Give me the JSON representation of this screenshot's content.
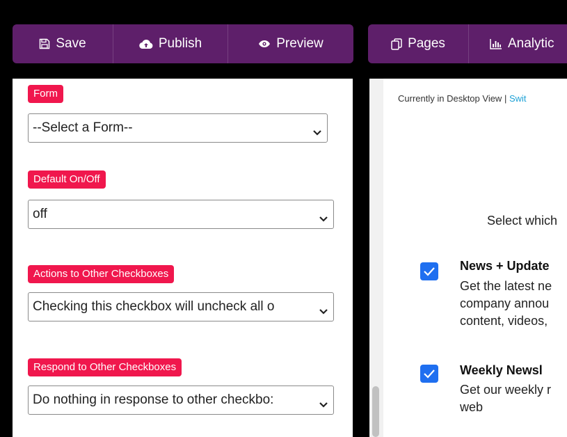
{
  "toolbar_left": [
    {
      "label": "Save",
      "icon": "floppy-disk-icon"
    },
    {
      "label": "Publish",
      "icon": "cloud-upload-icon"
    },
    {
      "label": "Preview",
      "icon": "eye-icon"
    }
  ],
  "toolbar_right": [
    {
      "label": "Pages",
      "icon": "pages-icon"
    },
    {
      "label": "Analytic",
      "icon": "bar-chart-icon"
    }
  ],
  "fields": {
    "form": {
      "label": "Form",
      "value": "--Select a Form--"
    },
    "default": {
      "label": "Default On/Off",
      "value": "off"
    },
    "actions": {
      "label": "Actions to Other Checkboxes",
      "value": "Checking this checkbox will uncheck all o"
    },
    "respond": {
      "label": "Respond to Other Checkboxes",
      "value": "Do nothing in response to other checkbo:"
    }
  },
  "preview": {
    "status_text": "Currently in Desktop View",
    "separator": "|",
    "switch_link": "Swit",
    "intro": "Select which",
    "options": [
      {
        "title": "News + Update",
        "desc": [
          "Get the latest ne",
          "company annou",
          "content, videos,"
        ],
        "checked": true
      },
      {
        "title": "Weekly Newsl",
        "desc": [
          "Get our weekly r",
          "web"
        ],
        "checked": true
      }
    ]
  },
  "colors": {
    "toolbar_bg": "#5e1f6a",
    "label_bg": "#f0174d",
    "checkbox_bg": "#1f6ff0",
    "link": "#1ea1d6"
  }
}
